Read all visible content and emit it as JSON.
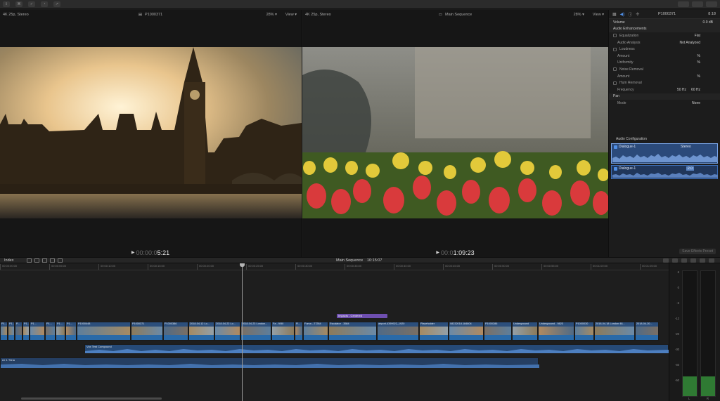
{
  "viewer_left": {
    "format": "4K 25p, Stereo",
    "clip_name": "P1000371",
    "zoom": "28%",
    "view_label": "View",
    "timecode_dim": "00:00:0",
    "timecode": "5:21"
  },
  "viewer_right": {
    "format": "4K 25p, Stereo",
    "title": "Main Sequence",
    "zoom": "28%",
    "view_label": "View",
    "timecode_dim": "00:0",
    "timecode": "1:09:23"
  },
  "inspector": {
    "clip_name": "P1000371",
    "duration": "8:18",
    "volume": {
      "label": "Volume",
      "value": "0.0 dB"
    },
    "audio_enhancements": "Audio Enhancements",
    "equalization": {
      "label": "Equalization",
      "value": "Flat"
    },
    "audio_analysis": {
      "label": "Audio Analysis",
      "value": "Not Analyzed"
    },
    "loudness": "Loudness",
    "amount1": {
      "label": "Amount",
      "value": "%"
    },
    "uniformity": {
      "label": "Uniformity",
      "value": "%"
    },
    "noise_removal": "Noise Removal",
    "amount2": {
      "label": "Amount",
      "value": "%"
    },
    "hum_removal": "Hum Removal",
    "frequency": {
      "label": "Frequency",
      "opt1": "50 Hz",
      "opt2": "60 Hz"
    },
    "pan": "Pan",
    "mode": {
      "label": "Mode",
      "value": "None"
    },
    "audio_configuration": "Audio Configuration",
    "lane1": {
      "name": "Dialogue-1",
      "format": "Stereo"
    },
    "lane2": {
      "name": "Dialogue-1",
      "format": "2.0"
    },
    "save_preset": "Save Effects Preset"
  },
  "timeline_bar": {
    "index": "Index",
    "sequence": "Main Sequence",
    "sequence_tc": "10:15:07"
  },
  "ruler_ticks": [
    "00:00:00:00",
    "00:00:05:00",
    "00:00:10:00",
    "00:00:15:00",
    "00:00:20:00",
    "00:00:25:00",
    "00:00:30:00",
    "00:00:35:00",
    "00:00:40:00",
    "00:00:45:00",
    "00:00:50:00",
    "00:00:55:00",
    "00:01:00:00",
    "00:01:05:00"
  ],
  "clips": [
    {
      "name": "P1...",
      "w": 11
    },
    {
      "name": "P1...",
      "w": 10
    },
    {
      "name": "P...",
      "w": 11
    },
    {
      "name": "P1...",
      "w": 10
    },
    {
      "name": "P1...",
      "w": 22
    },
    {
      "name": "P1...",
      "w": 15
    },
    {
      "name": "P1...",
      "w": 14
    },
    {
      "name": "P1...",
      "w": 16
    },
    {
      "name": "P1000448",
      "w": 77
    },
    {
      "name": "P1000371",
      "w": 46
    },
    {
      "name": "P1000386",
      "w": 36
    },
    {
      "name": "2018-04-12 Lo...",
      "w": 37
    },
    {
      "name": "2018-04-22 Lo...",
      "w": 37
    },
    {
      "name": "2018-04-23 London...",
      "w": 44
    },
    {
      "name": "Fa - 9/50",
      "w": 33
    },
    {
      "name": "Fl...",
      "w": 12
    },
    {
      "name": "Fuma - 27284",
      "w": 36
    },
    {
      "name": "Escalator - 3584",
      "w": 69
    },
    {
      "name": "airport-4399922_1920",
      "w": 60
    },
    {
      "name": "Placeholder",
      "w": 42
    },
    {
      "name": "08232018.184804",
      "w": 50
    },
    {
      "name": "P1000286",
      "w": 40
    },
    {
      "name": "Underground",
      "w": 37
    },
    {
      "name": "Underground - 9823",
      "w": 52
    },
    {
      "name": "P1000030",
      "w": 28
    },
    {
      "name": "2018-04-18 London 48...",
      "w": 58
    },
    {
      "name": "2018-04-20...",
      "w": 34
    }
  ],
  "connected_title": "Impacts - Centered",
  "compound_clip": "Vox Test Compound",
  "music_clip": "ee 1 Trina",
  "meter_labels": [
    "6",
    "0",
    "-6",
    "-12",
    "-20",
    "-30",
    "-40",
    "-50"
  ],
  "meter_channels": [
    "L",
    "R"
  ],
  "meter_levels": {
    "left": 0.16,
    "right": 0.16
  }
}
